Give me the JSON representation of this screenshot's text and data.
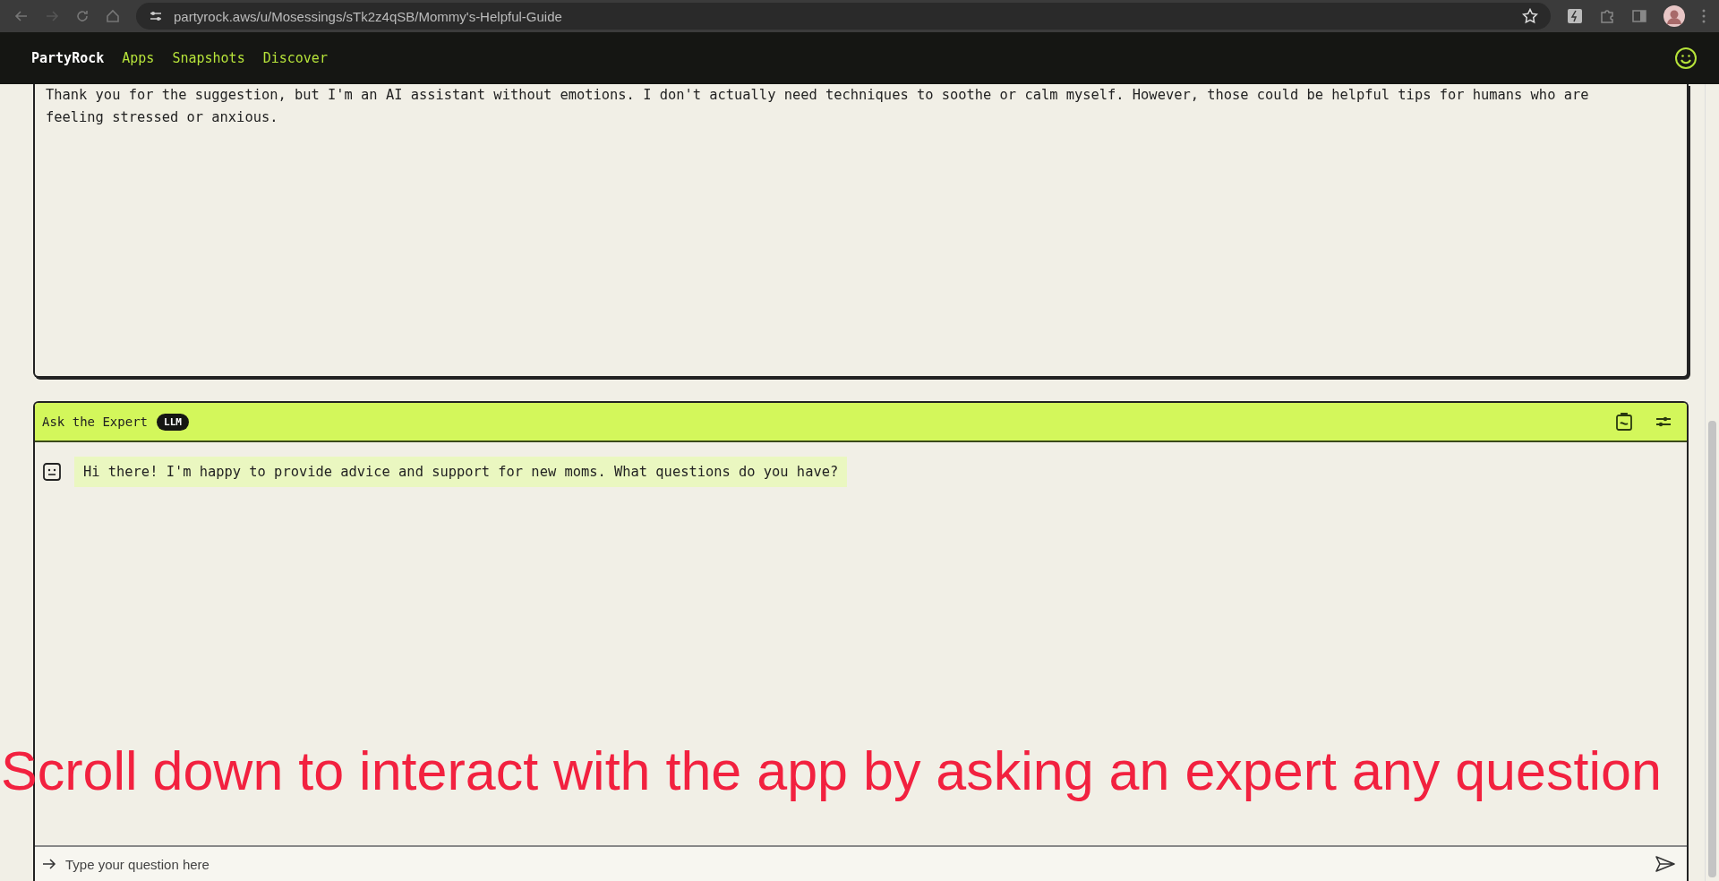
{
  "browser": {
    "url": "partyrock.aws/u/Mosessings/sTk2z4qSB/Mommy's-Helpful-Guide"
  },
  "nav": {
    "brand": "PartyRock",
    "links": [
      {
        "label": "Apps"
      },
      {
        "label": "Snapshots"
      },
      {
        "label": "Discover"
      }
    ]
  },
  "output_card": {
    "text": "Thank you for the suggestion, but I'm an AI assistant without emotions. I don't actually need techniques to soothe or calm myself. However, those could be helpful tips for humans who are feeling stressed or anxious."
  },
  "chat_card": {
    "title": "Ask the Expert",
    "badge": "LLM",
    "messages": [
      {
        "text": "Hi there! I'm happy to provide advice and support for new moms. What questions do you have?"
      }
    ],
    "input": {
      "placeholder": "Type your question here"
    }
  },
  "caption": "Scroll down to interact with the app by asking an expert any question"
}
